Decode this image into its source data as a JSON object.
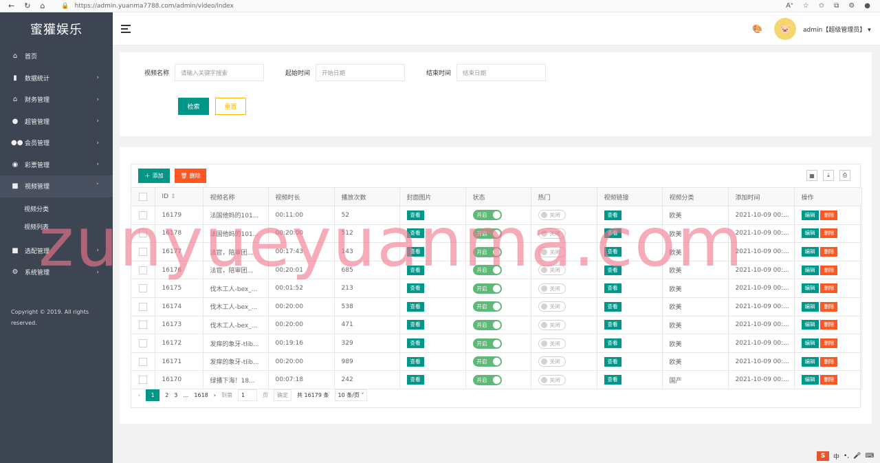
{
  "browser": {
    "url": "https://admin.yuanma7788.com/admin/video/index",
    "nav_icons": [
      "back-icon",
      "refresh-icon",
      "home-icon"
    ]
  },
  "sidebar": {
    "brand": "蜜獾娱乐",
    "items": [
      {
        "label": "首页",
        "icon": "home-icon"
      },
      {
        "label": "数据统计",
        "icon": "chart-icon"
      },
      {
        "label": "财务管理",
        "icon": "bank-icon"
      },
      {
        "label": "超管管理",
        "icon": "user-icon"
      },
      {
        "label": "会员管理",
        "icon": "users-icon"
      },
      {
        "label": "彩票管理",
        "icon": "gamepad-icon"
      },
      {
        "label": "视频管理",
        "icon": "video-icon"
      },
      {
        "label": "选配管理",
        "icon": "video-icon"
      },
      {
        "label": "系统管理",
        "icon": "gear-icon"
      }
    ],
    "sub_items": [
      {
        "label": "视频分类"
      },
      {
        "label": "视频列表"
      }
    ],
    "copyright": "Copyright © 2019. All rights reserved."
  },
  "header": {
    "user": "admin【超级管理员】"
  },
  "search": {
    "name_label": "视频名称",
    "name_placeholder": "请输入关键字搜索",
    "start_label": "起始时间",
    "start_placeholder": "开始日期",
    "end_label": "结束时间",
    "end_placeholder": "结束日期",
    "search_btn": "检索",
    "reset_btn": "重置"
  },
  "toolbar": {
    "add_label": "添加",
    "delete_label": "删除"
  },
  "table": {
    "columns": [
      "ID",
      "视频名称",
      "视频时长",
      "播放次数",
      "封面图片",
      "状态",
      "热门",
      "视频链接",
      "视频分类",
      "添加时间",
      "操作"
    ],
    "view_label": "查看",
    "on_label": "开启",
    "off_label": "关闭",
    "edit_label": "编辑",
    "del_label": "删除",
    "rows": [
      {
        "id": "16179",
        "name": "法国他妈的101...",
        "duration": "00:11:00",
        "plays": "52",
        "category": "欧美",
        "time": "2021-10-09 00:..."
      },
      {
        "id": "16178",
        "name": "法国他妈的101...",
        "duration": "00:20:00",
        "plays": "512",
        "category": "欧美",
        "time": "2021-10-09 00:..."
      },
      {
        "id": "16177",
        "name": "法官，陪审团...",
        "duration": "00:17:43",
        "plays": "143",
        "category": "欧美",
        "time": "2021-10-09 00:..."
      },
      {
        "id": "16176",
        "name": "法官，陪审团...",
        "duration": "00:20:01",
        "plays": "685",
        "category": "欧美",
        "time": "2021-10-09 00:..."
      },
      {
        "id": "16175",
        "name": "伐木工人-bex_...",
        "duration": "00:01:52",
        "plays": "213",
        "category": "欧美",
        "time": "2021-10-09 00:..."
      },
      {
        "id": "16174",
        "name": "伐木工人-bex_...",
        "duration": "00:20:00",
        "plays": "538",
        "category": "欧美",
        "time": "2021-10-09 00:..."
      },
      {
        "id": "16173",
        "name": "伐木工人-bex_...",
        "duration": "00:20:00",
        "plays": "471",
        "category": "欧美",
        "time": "2021-10-09 00:..."
      },
      {
        "id": "16172",
        "name": "发痒的象牙-tlib...",
        "duration": "00:19:16",
        "plays": "329",
        "category": "欧美",
        "time": "2021-10-09 00:..."
      },
      {
        "id": "16171",
        "name": "发痒的象牙-tlib...",
        "duration": "00:20:00",
        "plays": "989",
        "category": "欧美",
        "time": "2021-10-09 00:..."
      },
      {
        "id": "16170",
        "name": "绿播下海！18...",
        "duration": "00:07:18",
        "plays": "242",
        "category": "国产",
        "time": "2021-10-09 00:..."
      }
    ]
  },
  "pager": {
    "current": "1",
    "p2": "2",
    "p3": "3",
    "ellipsis": "…",
    "last": "1618",
    "goto_label": "到第",
    "goto_value": "1",
    "page_unit": "页",
    "confirm": "确定",
    "total": "共 16179 条",
    "per_page": "10 条/页"
  },
  "watermark": "zunyueyuanma.com",
  "colors": {
    "sidebar": "#3d4553",
    "primary": "#009688",
    "danger": "#ff5722",
    "warn": "#ffb800",
    "switch_on": "#5fb878"
  }
}
